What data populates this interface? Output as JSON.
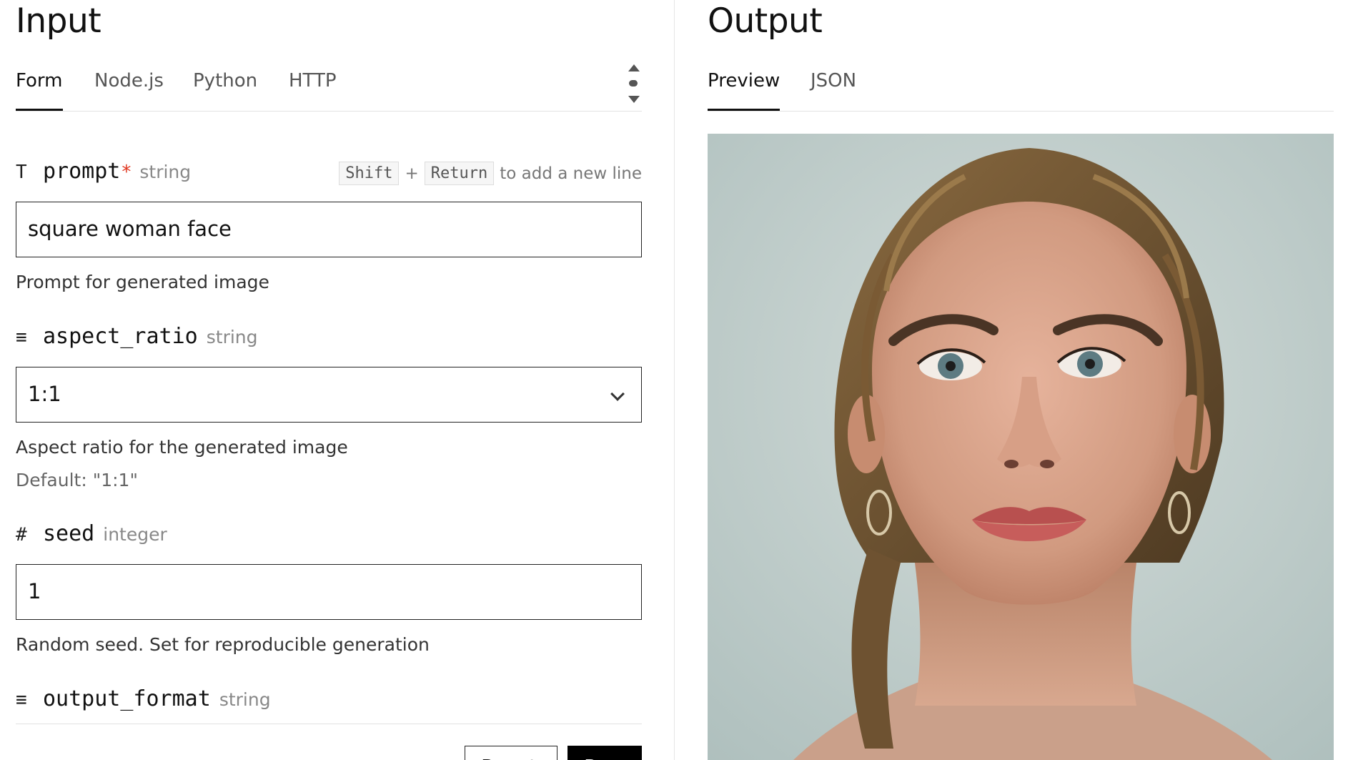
{
  "input_panel": {
    "title": "Input",
    "tabs": [
      {
        "label": "Form",
        "active": true
      },
      {
        "label": "Node.js",
        "active": false
      },
      {
        "label": "Python",
        "active": false
      },
      {
        "label": "HTTP",
        "active": false
      }
    ],
    "hint": {
      "key1": "Shift",
      "plus": "+",
      "key2": "Return",
      "text": "to add a new line"
    },
    "fields": {
      "prompt": {
        "icon": "T",
        "name": "prompt",
        "required_marker": "*",
        "type": "string",
        "value": "square woman face",
        "description": "Prompt for generated image"
      },
      "aspect_ratio": {
        "icon": "≡",
        "name": "aspect_ratio",
        "type": "string",
        "value": "1:1",
        "description": "Aspect ratio for the generated image",
        "default_text": "Default: \"1:1\""
      },
      "seed": {
        "icon": "#",
        "name": "seed",
        "type": "integer",
        "value": "1",
        "description": "Random seed. Set for reproducible generation"
      },
      "output_format": {
        "icon": "≡",
        "name": "output_format",
        "type": "string"
      }
    },
    "buttons": {
      "reset": "Reset",
      "run": "Run"
    }
  },
  "output_panel": {
    "title": "Output",
    "tabs": [
      {
        "label": "Preview",
        "active": true
      },
      {
        "label": "JSON",
        "active": false
      }
    ],
    "preview": {
      "subject": "generated portrait of a woman's face"
    }
  },
  "colors": {
    "accent": "#000000",
    "required": "#e0361f",
    "border": "#222222",
    "muted_text": "#888888"
  }
}
